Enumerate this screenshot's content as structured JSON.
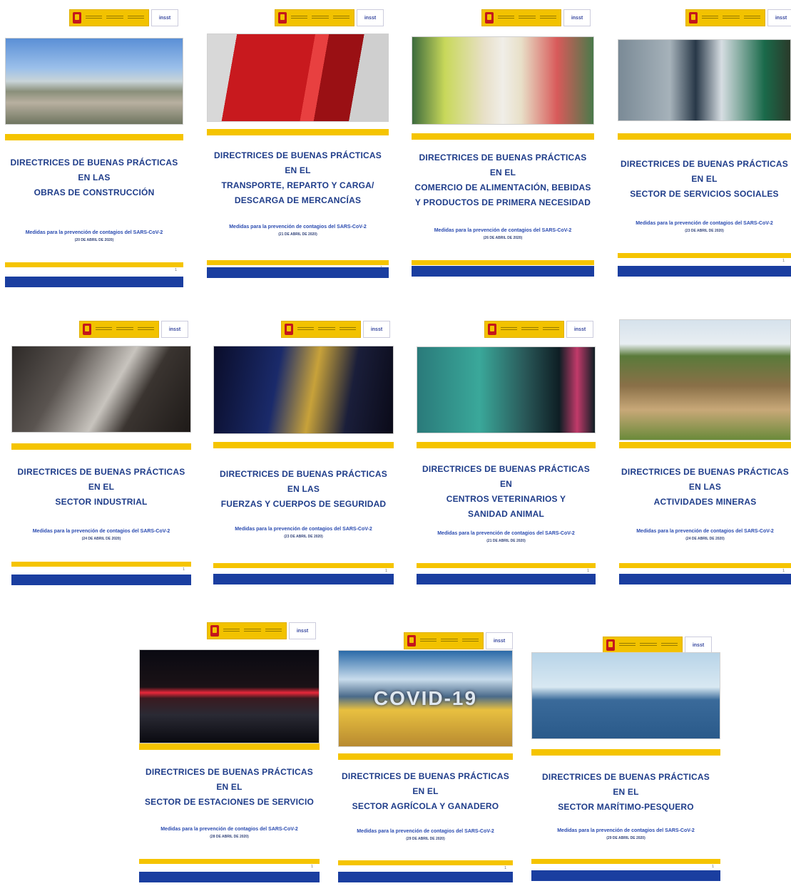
{
  "logo": {
    "insst_text": "insst"
  },
  "subtitle_text": "Medidas para la prevención de contagios del SARS-CoV-2",
  "page_number": "1",
  "colors": {
    "brand_yellow": "#f5c400",
    "brand_blue": "#1a3ea0",
    "title_blue": "#1f3d8a"
  },
  "covers": [
    {
      "line1": "DIRECTRICES DE BUENAS PRÁCTICAS",
      "line2": "EN LAS",
      "line3": "OBRAS DE CONSTRUCCIÓN",
      "line4": "",
      "date": "(20 DE ABRIL DE 2020)",
      "photo": "construction-site-photo"
    },
    {
      "line1": "DIRECTRICES DE BUENAS PRÁCTICAS",
      "line2": "EN EL",
      "line3": "TRANSPORTE, REPARTO Y CARGA/",
      "line4": "DESCARGA DE MERCANCÍAS",
      "date": "(21 DE ABRIL DE 2020)",
      "photo": "truck-driver-photo"
    },
    {
      "line1": "DIRECTRICES DE BUENAS PRÁCTICAS",
      "line2": "EN EL",
      "line3": "COMERCIO DE ALIMENTACIÓN, BEBIDAS",
      "line4": "Y PRODUCTOS DE PRIMERA NECESIDAD",
      "date": "(26 DE ABRIL DE 2020)",
      "photo": "supermarket-aisle-photo"
    },
    {
      "line1": "DIRECTRICES DE BUENAS PRÁCTICAS",
      "line2": "EN EL",
      "line3": "SECTOR DE SERVICIOS SOCIALES",
      "line4": "",
      "date": "(23 DE ABRIL DE 2020)",
      "photo": "social-services-photo"
    },
    {
      "line1": "DIRECTRICES DE BUENAS PRÁCTICAS",
      "line2": "EN EL",
      "line3": "SECTOR INDUSTRIAL",
      "line4": "",
      "date": "(24 DE ABRIL DE 2020)",
      "photo": "industrial-plant-photo"
    },
    {
      "line1": "DIRECTRICES DE BUENAS PRÁCTICAS",
      "line2": "EN LAS",
      "line3": "FUERZAS Y CUERPOS DE SEGURIDAD",
      "line4": "",
      "date": "(23 DE ABRIL DE 2020)",
      "photo": "police-night-photo"
    },
    {
      "line1": "DIRECTRICES DE BUENAS PRÁCTICAS",
      "line2": "EN",
      "line3": "CENTROS VETERINARIOS Y",
      "line4": "SANIDAD ANIMAL",
      "date": "(21 DE ABRIL DE 2020)",
      "photo": "veterinary-surgery-photo"
    },
    {
      "line1": "DIRECTRICES DE BUENAS PRÁCTICAS",
      "line2": "EN LAS",
      "line3": "ACTIVIDADES MINERAS",
      "line4": "",
      "date": "(24 DE ABRIL DE 2020)",
      "photo": "mining-site-photo"
    },
    {
      "line1": "DIRECTRICES DE BUENAS PRÁCTICAS",
      "line2": "EN EL",
      "line3": "SECTOR DE ESTACIONES DE SERVICIO",
      "line4": "",
      "date": "(28 DE ABRIL DE 2020)",
      "photo": "gas-station-photo"
    },
    {
      "line1": "DIRECTRICES DE BUENAS PRÁCTICAS",
      "line2": "EN EL",
      "line3": "SECTOR AGRÍCOLA Y GANADERO",
      "line4": "",
      "date": "(29 DE ABRIL DE 2020)",
      "photo": "covid19-field-photo",
      "photo_text": "COVID-19"
    },
    {
      "line1": "DIRECTRICES DE BUENAS PRÁCTICAS",
      "line2": "EN EL",
      "line3": "SECTOR MARÍTIMO-PESQUERO",
      "line4": "",
      "date": "(29 DE ABRIL DE 2020)",
      "photo": "fishing-boat-photo"
    }
  ]
}
